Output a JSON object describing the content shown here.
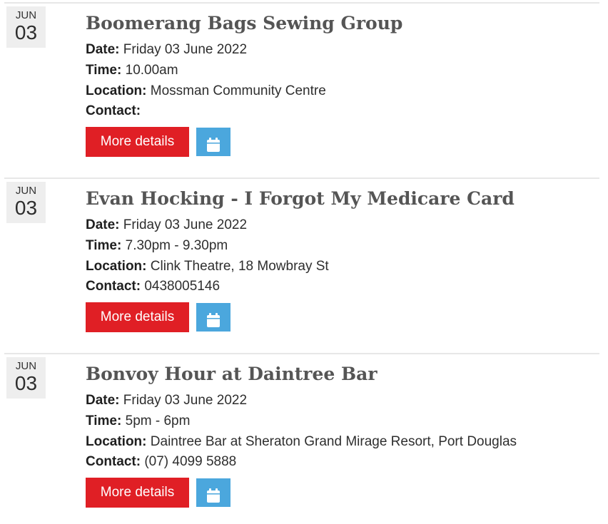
{
  "events": [
    {
      "month": "JUN",
      "day": "03",
      "title": "Boomerang Bags Sewing Group",
      "date_label": "Date:",
      "date": "Friday 03 June 2022",
      "time_label": "Time:",
      "time": "10.00am",
      "location_label": "Location:",
      "location": "Mossman Community Centre",
      "contact_label": "Contact:",
      "contact": "",
      "more_label": "More details",
      "calendar_icon": "calendar-icon"
    },
    {
      "month": "JUN",
      "day": "03",
      "title": "Evan Hocking - I Forgot My Medicare Card",
      "date_label": "Date:",
      "date": "Friday 03 June 2022",
      "time_label": "Time:",
      "time": "7.30pm - 9.30pm",
      "location_label": "Location:",
      "location": "Clink Theatre, 18 Mowbray St",
      "contact_label": "Contact:",
      "contact": "0438005146",
      "more_label": "More details",
      "calendar_icon": "calendar-icon"
    },
    {
      "month": "JUN",
      "day": "03",
      "title": "Bonvoy Hour at Daintree Bar",
      "date_label": "Date:",
      "date": "Friday 03 June 2022",
      "time_label": "Time:",
      "time": "5pm - 6pm",
      "location_label": "Location:",
      "location": "Daintree Bar at Sheraton Grand Mirage Resort, Port Douglas",
      "contact_label": "Contact:",
      "contact": "(07) 4099 5888",
      "more_label": "More details",
      "calendar_icon": "calendar-icon"
    }
  ],
  "colors": {
    "accent_red": "#e01f25",
    "calendar_blue": "#4ba7dd",
    "title_gray": "#555555",
    "badge_bg": "#eeeeee"
  }
}
